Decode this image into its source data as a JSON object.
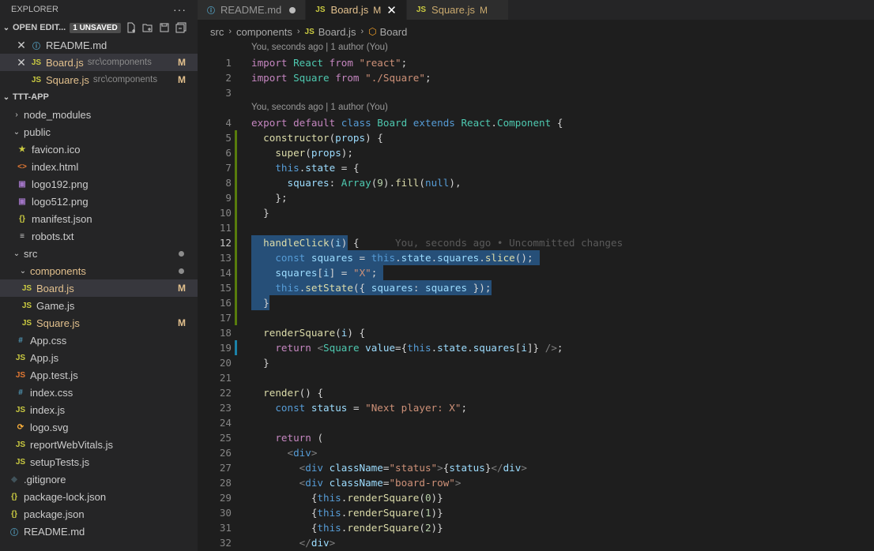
{
  "explorer": {
    "title": "EXPLORER",
    "more": "···",
    "open_editors": {
      "label": "OPEN EDIT...",
      "badge": "1 UNSAVED",
      "items": [
        {
          "name": "README.md",
          "desc": "",
          "mark": "",
          "icon": "ⓘ"
        },
        {
          "name": "Board.js",
          "desc": "src\\components",
          "mark": "M",
          "icon": "JS"
        },
        {
          "name": "Square.js",
          "desc": "src\\components",
          "mark": "M",
          "icon": "JS"
        }
      ]
    },
    "project": {
      "label": "TTT-APP",
      "tree": [
        {
          "name": "node_modules",
          "type": "folder-closed"
        },
        {
          "name": "public",
          "type": "folder-open"
        },
        {
          "name": "favicon.ico",
          "type": "file",
          "icon": "★"
        },
        {
          "name": "index.html",
          "type": "file",
          "icon": "<>"
        },
        {
          "name": "logo192.png",
          "type": "file",
          "icon": "▣"
        },
        {
          "name": "logo512.png",
          "type": "file",
          "icon": "▣"
        },
        {
          "name": "manifest.json",
          "type": "file",
          "icon": "{}"
        },
        {
          "name": "robots.txt",
          "type": "file",
          "icon": "≡"
        },
        {
          "name": "src",
          "type": "folder-open"
        },
        {
          "name": "components",
          "type": "folder-open"
        },
        {
          "name": "Board.js",
          "type": "file",
          "icon": "JS",
          "mark": "M"
        },
        {
          "name": "Game.js",
          "type": "file",
          "icon": "JS"
        },
        {
          "name": "Square.js",
          "type": "file",
          "icon": "JS",
          "mark": "M"
        },
        {
          "name": "App.css",
          "type": "file",
          "icon": "#"
        },
        {
          "name": "App.js",
          "type": "file",
          "icon": "JS"
        },
        {
          "name": "App.test.js",
          "type": "file",
          "icon": "JS"
        },
        {
          "name": "index.css",
          "type": "file",
          "icon": "#"
        },
        {
          "name": "index.js",
          "type": "file",
          "icon": "JS"
        },
        {
          "name": "logo.svg",
          "type": "file",
          "icon": "⟳"
        },
        {
          "name": "reportWebVitals.js",
          "type": "file",
          "icon": "JS"
        },
        {
          "name": "setupTests.js",
          "type": "file",
          "icon": "JS"
        },
        {
          "name": ".gitignore",
          "type": "file",
          "icon": "◆"
        },
        {
          "name": "package-lock.json",
          "type": "file",
          "icon": "{}"
        },
        {
          "name": "package.json",
          "type": "file",
          "icon": "{}"
        },
        {
          "name": "README.md",
          "type": "file",
          "icon": "ⓘ"
        }
      ]
    }
  },
  "tabs": [
    {
      "label": "README.md",
      "icon": "ⓘ",
      "mark": "",
      "unsaved": true
    },
    {
      "label": "Board.js",
      "icon": "JS",
      "mark": "M",
      "active": true
    },
    {
      "label": "Square.js",
      "icon": "JS",
      "mark": "M"
    }
  ],
  "breadcrumb": [
    "src",
    "components",
    "Board.js",
    "Board"
  ],
  "codelens": "You, seconds ago | 1 author (You)",
  "blame_inline": "You, seconds ago • Uncommitted changes",
  "lines": [
    "import React from \"react\";",
    "import Square from \"./Square\";",
    "",
    "export default class Board extends React.Component {",
    "  constructor(props) {",
    "    super(props);",
    "    this.state = {",
    "      squares: Array(9).fill(null),",
    "    };",
    "  }",
    "",
    "  handleClick(i) {",
    "    const squares = this.state.squares.slice();",
    "    squares[i] = \"X\";",
    "    this.setState({ squares: squares });",
    "  }",
    "",
    "  renderSquare(i) {",
    "    return <Square value={this.state.squares[i]} />;",
    "  }",
    "",
    "  render() {",
    "    const status = \"Next player: X\";",
    "",
    "    return (",
    "      <div>",
    "        <div className=\"status\">{status}</div>",
    "        <div className=\"board-row\">",
    "          {this.renderSquare(0)}",
    "          {this.renderSquare(1)}",
    "          {this.renderSquare(2)}",
    "        </div>"
  ]
}
